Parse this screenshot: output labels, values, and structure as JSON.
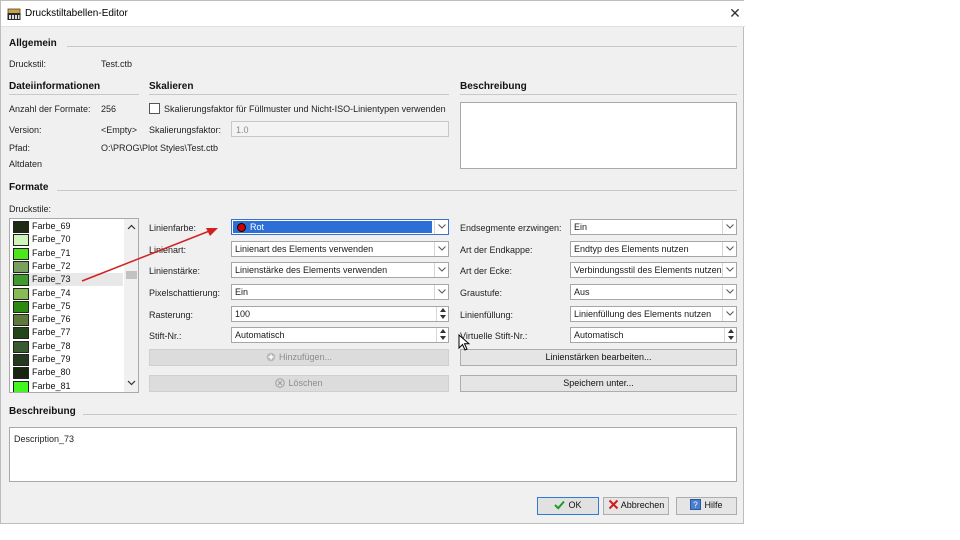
{
  "window": {
    "title": "Druckstiltabellen-Editor"
  },
  "general": {
    "heading": "Allgemein",
    "druckstil_label": "Druckstil:",
    "druckstil_value": "Test.ctb"
  },
  "fileinfo": {
    "heading": "Dateiinformationen",
    "count_label": "Anzahl der Formate:",
    "count_value": "256",
    "version_label": "Version:",
    "version_value": "<Empty>",
    "path_label": "Pfad:",
    "path_value": "O:\\PROG\\Plot Styles\\Test.ctb",
    "legacy_label": "Altdaten"
  },
  "scaling": {
    "heading": "Skalieren",
    "checkbox_label": "Skalierungsfaktor für Füllmuster und Nicht-ISO-Linientypen verwenden",
    "checked": false,
    "factor_label": "Skalierungsfaktor:",
    "factor_value": "1.0"
  },
  "description_top": {
    "heading": "Beschreibung",
    "value": ""
  },
  "formats": {
    "heading": "Formate",
    "styles_label": "Druckstile:",
    "items": [
      {
        "name": "Farbe_69",
        "color": "#1c2b12"
      },
      {
        "name": "Farbe_70",
        "color": "#d0f5ba"
      },
      {
        "name": "Farbe_71",
        "color": "#4ee61a"
      },
      {
        "name": "Farbe_72",
        "color": "#7aa060"
      },
      {
        "name": "Farbe_73",
        "color": "#3f9a2c"
      },
      {
        "name": "Farbe_74",
        "color": "#88bb55"
      },
      {
        "name": "Farbe_75",
        "color": "#2d8a10"
      },
      {
        "name": "Farbe_76",
        "color": "#5d7a3a"
      },
      {
        "name": "Farbe_77",
        "color": "#22451a"
      },
      {
        "name": "Farbe_78",
        "color": "#3a5a30"
      },
      {
        "name": "Farbe_79",
        "color": "#253820"
      },
      {
        "name": "Farbe_80",
        "color": "#162410"
      },
      {
        "name": "Farbe_81",
        "color": "#43f521"
      }
    ],
    "selected_index": 4
  },
  "props_left": {
    "linienfarbe_label": "Linienfarbe:",
    "linienfarbe_value": "Rot",
    "linienfarbe_dot": "#d40000",
    "linienart_label": "Linienart:",
    "linienart_value": "Linienart des Elements verwenden",
    "linienstaerke_label": "Linienstärke:",
    "linienstaerke_value": "Linienstärke des Elements verwenden",
    "pixelschattierung_label": "Pixelschattierung:",
    "pixelschattierung_value": "Ein",
    "rasterung_label": "Rasterung:",
    "rasterung_value": "100",
    "stift_label": "Stift-Nr.:",
    "stift_value": "Automatisch",
    "add_button": "Hinzufügen...",
    "delete_button": "Löschen"
  },
  "props_right": {
    "endsegmente_label": "Endsegmente erzwingen:",
    "endsegmente_value": "Ein",
    "endkappe_label": "Art der Endkappe:",
    "endkappe_value": "Endtyp des Elements nutzen",
    "ecke_label": "Art der Ecke:",
    "ecke_value": "Verbindungsstil des Elements nutzen",
    "graustufe_label": "Graustufe:",
    "graustufe_value": "Aus",
    "linienfuellung_label": "Linienfüllung:",
    "linienfuellung_value": "Linienfüllung des Elements nutzen",
    "virtuell_label": "Virtuelle Stift-Nr.:",
    "virtuell_value": "Automatisch",
    "edit_weights_button": "Linienstärken bearbeiten...",
    "save_as_button": "Speichern unter..."
  },
  "description_bottom": {
    "heading": "Beschreibung",
    "value": "Description_73"
  },
  "footer": {
    "ok": "OK",
    "cancel": "Abbrechen",
    "help": "Hilfe"
  },
  "colors": {
    "accent": "#2c6fd6",
    "arrow": "#d22020",
    "ok_check": "#1f9b2a",
    "cancel_x": "#d21b1b"
  }
}
